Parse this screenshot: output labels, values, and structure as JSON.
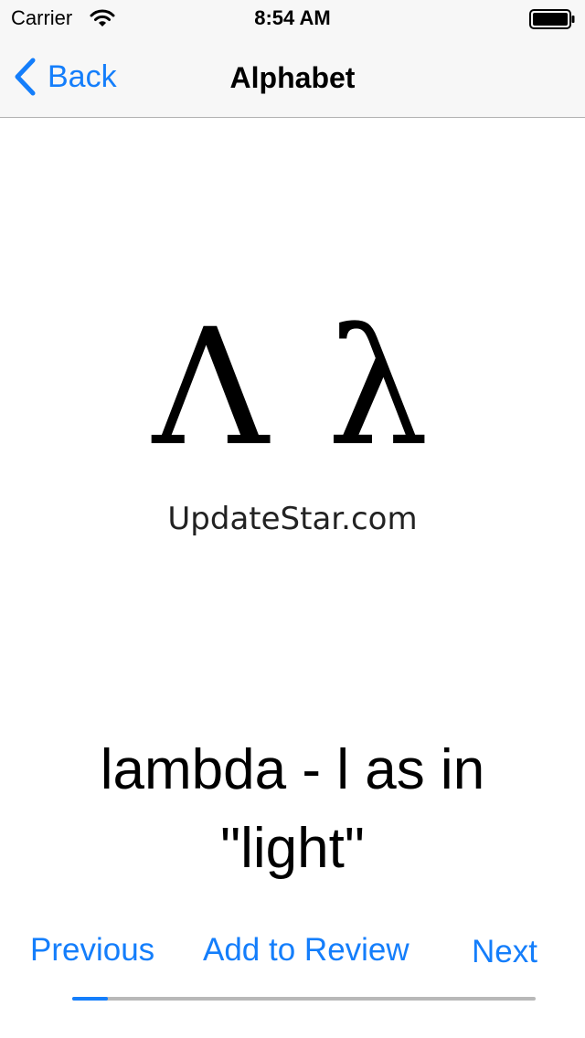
{
  "status_bar": {
    "carrier": "Carrier",
    "time": "8:54 AM",
    "icons": [
      "wifi-icon",
      "battery-icon"
    ]
  },
  "nav": {
    "back_label": "Back",
    "back_icon": "chevron-left-icon",
    "title": "Alphabet"
  },
  "letter": {
    "glyphs": "Λ λ",
    "watermark": "UpdateStar.com"
  },
  "description": "lambda - l as in \"light\"",
  "controls": {
    "previous_label": "Previous",
    "review_label": "Add to Review",
    "next_label": "Next"
  },
  "progress": {
    "fraction": 0.077
  },
  "colors": {
    "accent": "#147efb",
    "bar_background": "#f7f7f7",
    "track": "#b8b8b8"
  }
}
